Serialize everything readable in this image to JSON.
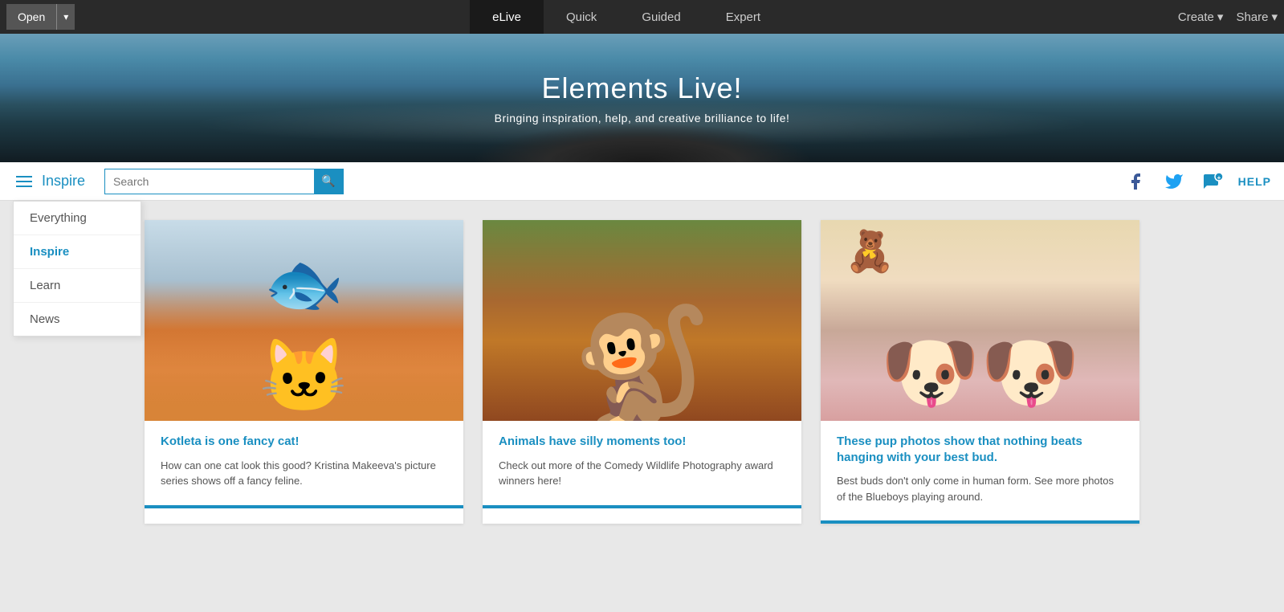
{
  "topNav": {
    "open_label": "Open",
    "open_dropdown_arrow": "▾",
    "tabs": [
      {
        "id": "elive",
        "label": "eLive",
        "active": true
      },
      {
        "id": "quick",
        "label": "Quick",
        "active": false
      },
      {
        "id": "guided",
        "label": "Guided",
        "active": false
      },
      {
        "id": "expert",
        "label": "Expert",
        "active": false
      }
    ],
    "create_label": "Create",
    "create_arrow": "▾",
    "share_label": "Share",
    "share_arrow": "▾"
  },
  "hero": {
    "title": "Elements Live!",
    "subtitle": "Bringing inspiration, help, and creative brilliance to life!"
  },
  "secondaryNav": {
    "current_section": "Inspire",
    "search_placeholder": "Search",
    "search_icon": "🔍",
    "facebook_icon": "f",
    "twitter_icon": "🐦",
    "chat_icon": "💬",
    "help_label": "HELP"
  },
  "dropdownMenu": {
    "items": [
      {
        "id": "everything",
        "label": "Everything",
        "active": false
      },
      {
        "id": "inspire",
        "label": "Inspire",
        "active": true
      },
      {
        "id": "learn",
        "label": "Learn",
        "active": false
      },
      {
        "id": "news",
        "label": "News",
        "active": false
      }
    ]
  },
  "cards": [
    {
      "id": "card-1",
      "image_type": "cat",
      "title": "Kotleta is one fancy cat!",
      "text": "How can one cat look this good? Kristina Makeeva's picture series shows off a fancy feline."
    },
    {
      "id": "card-2",
      "image_type": "lemur",
      "title": "Animals have silly moments too!",
      "text": "Check out more of the Comedy Wildlife Photography award winners here!"
    },
    {
      "id": "card-3",
      "image_type": "dogs",
      "title": "These pup photos show that nothing beats hanging with your best bud.",
      "text": "Best buds don't only come in human form. See more photos of the Blueboys playing around."
    }
  ]
}
